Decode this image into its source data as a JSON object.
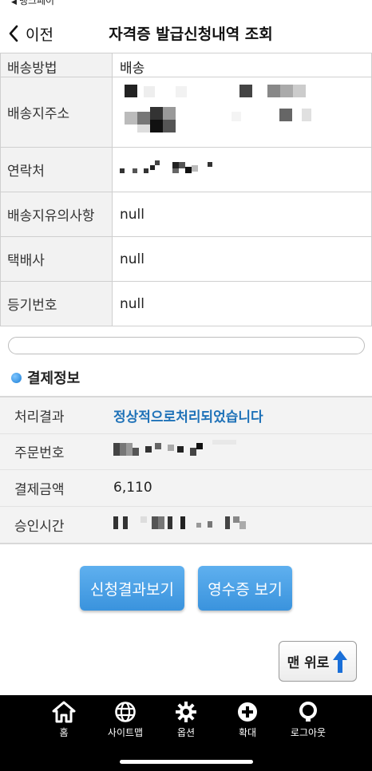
{
  "status_bar": {
    "back_app": "뱅크페이"
  },
  "nav": {
    "back_label": "이전",
    "title": "자격증 발급신청내역 조회"
  },
  "shipping": {
    "rows": [
      {
        "label": "배송방법",
        "value": "배송"
      },
      {
        "label": "배송지주소",
        "value": ""
      },
      {
        "label": "연락처",
        "value": ""
      },
      {
        "label": "배송지유의사항",
        "value": "null"
      },
      {
        "label": "택배사",
        "value": "null"
      },
      {
        "label": "등기번호",
        "value": "null"
      }
    ]
  },
  "payment": {
    "section_title": "결제정보",
    "rows": [
      {
        "label": "처리결과",
        "value": "정상적으로처리되었습니다"
      },
      {
        "label": "주문번호",
        "value": ""
      },
      {
        "label": "결제금액",
        "value": "6,110"
      },
      {
        "label": "승인시간",
        "value": ""
      }
    ]
  },
  "buttons": {
    "result": "신청결과보기",
    "receipt": "영수증 보기",
    "top": "맨 위로"
  },
  "tabbar": {
    "items": [
      {
        "label": "홈",
        "icon": "home-icon"
      },
      {
        "label": "사이트맵",
        "icon": "globe-icon"
      },
      {
        "label": "옵션",
        "icon": "gear-icon"
      },
      {
        "label": "확대",
        "icon": "plus-circle-icon"
      },
      {
        "label": "로그아웃",
        "icon": "logout-icon"
      }
    ]
  },
  "colors": {
    "accent": "#3a93dd",
    "status_ok": "#1f72b8",
    "tabbar": "#000000"
  }
}
